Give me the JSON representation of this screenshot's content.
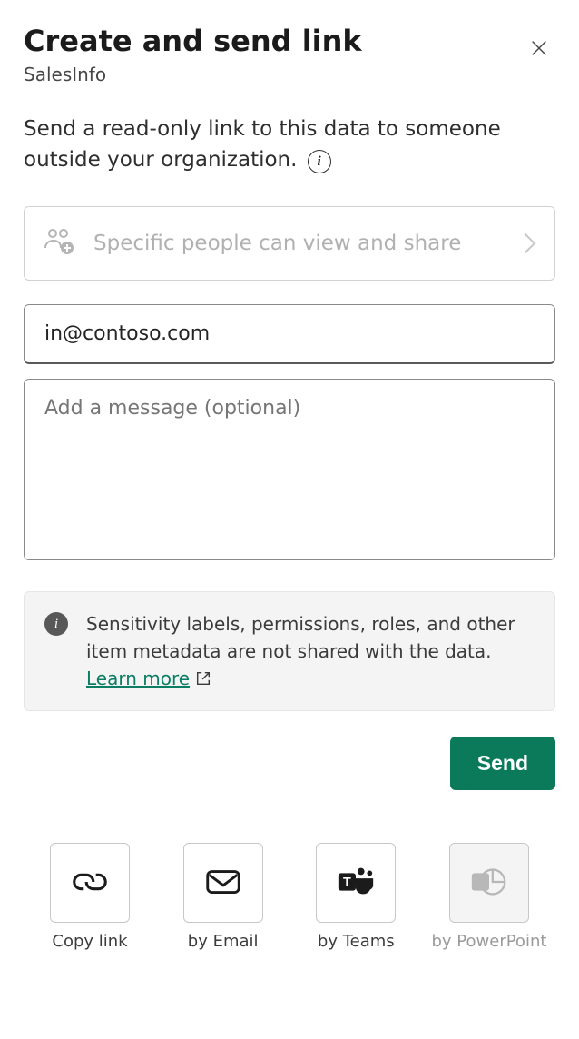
{
  "header": {
    "title": "Create and send link",
    "subtitle": "SalesInfo"
  },
  "description": "Send a read-only link to this data to someone outside your organization.",
  "permission": {
    "text": "Specific people can view and share"
  },
  "email": {
    "value": "in@contoso.com",
    "placeholder": ""
  },
  "message": {
    "value": "",
    "placeholder": "Add a message (optional)"
  },
  "notice": {
    "text": "Sensitivity labels, permissions, roles, and other item metadata are not shared with the data.",
    "learn_more_label": "Learn more"
  },
  "buttons": {
    "send": "Send"
  },
  "share_actions": [
    {
      "label": "Copy link"
    },
    {
      "label": "by Email"
    },
    {
      "label": "by Teams"
    },
    {
      "label": "by PowerPoint"
    }
  ]
}
